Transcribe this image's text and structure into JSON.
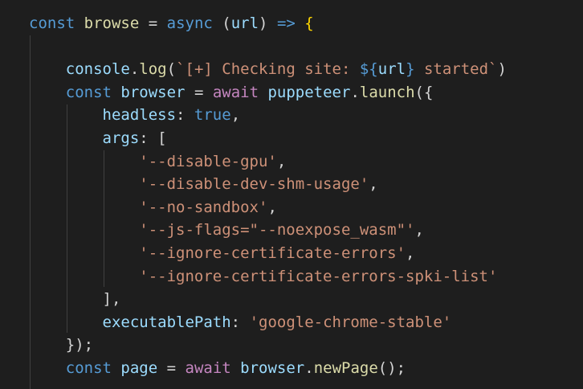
{
  "theme": {
    "background": "#1e1e1e",
    "keyword": "#569cd6",
    "control": "#c586c0",
    "variable": "#9cdcfe",
    "function": "#dcdcaa",
    "string": "#ce9178",
    "plain": "#d4d4d4",
    "bracket": "#ffd700",
    "guide": "#404040"
  },
  "code": {
    "lines": [
      [
        {
          "t": "const",
          "c": "keyword"
        },
        {
          "t": " ",
          "c": "plain"
        },
        {
          "t": "browse",
          "c": "function"
        },
        {
          "t": " = ",
          "c": "plain"
        },
        {
          "t": "async",
          "c": "keyword"
        },
        {
          "t": " (",
          "c": "plain"
        },
        {
          "t": "url",
          "c": "variable"
        },
        {
          "t": ") ",
          "c": "plain"
        },
        {
          "t": "=>",
          "c": "keyword"
        },
        {
          "t": " ",
          "c": "plain"
        },
        {
          "t": "{",
          "c": "bracket"
        }
      ],
      [],
      [
        {
          "t": "    ",
          "c": "plain"
        },
        {
          "t": "console",
          "c": "variable"
        },
        {
          "t": ".",
          "c": "plain"
        },
        {
          "t": "log",
          "c": "function"
        },
        {
          "t": "(",
          "c": "plain"
        },
        {
          "t": "`[+] Checking site: ",
          "c": "string"
        },
        {
          "t": "${",
          "c": "keyword"
        },
        {
          "t": "url",
          "c": "variable"
        },
        {
          "t": "}",
          "c": "keyword"
        },
        {
          "t": " started`",
          "c": "string"
        },
        {
          "t": ")",
          "c": "plain"
        }
      ],
      [
        {
          "t": "    ",
          "c": "plain"
        },
        {
          "t": "const",
          "c": "keyword"
        },
        {
          "t": " ",
          "c": "plain"
        },
        {
          "t": "browser",
          "c": "variable"
        },
        {
          "t": " = ",
          "c": "plain"
        },
        {
          "t": "await",
          "c": "control"
        },
        {
          "t": " ",
          "c": "plain"
        },
        {
          "t": "puppeteer",
          "c": "variable"
        },
        {
          "t": ".",
          "c": "plain"
        },
        {
          "t": "launch",
          "c": "function"
        },
        {
          "t": "({",
          "c": "plain"
        }
      ],
      [
        {
          "t": "        ",
          "c": "plain"
        },
        {
          "t": "headless",
          "c": "variable"
        },
        {
          "t": ": ",
          "c": "plain"
        },
        {
          "t": "true",
          "c": "keyword"
        },
        {
          "t": ",",
          "c": "plain"
        }
      ],
      [
        {
          "t": "        ",
          "c": "plain"
        },
        {
          "t": "args",
          "c": "variable"
        },
        {
          "t": ": [",
          "c": "plain"
        }
      ],
      [
        {
          "t": "            ",
          "c": "plain"
        },
        {
          "t": "'--disable-gpu'",
          "c": "string"
        },
        {
          "t": ",",
          "c": "plain"
        }
      ],
      [
        {
          "t": "            ",
          "c": "plain"
        },
        {
          "t": "'--disable-dev-shm-usage'",
          "c": "string"
        },
        {
          "t": ",",
          "c": "plain"
        }
      ],
      [
        {
          "t": "            ",
          "c": "plain"
        },
        {
          "t": "'--no-sandbox'",
          "c": "string"
        },
        {
          "t": ",",
          "c": "plain"
        }
      ],
      [
        {
          "t": "            ",
          "c": "plain"
        },
        {
          "t": "'--js-flags=\"--noexpose_wasm\"'",
          "c": "string"
        },
        {
          "t": ",",
          "c": "plain"
        }
      ],
      [
        {
          "t": "            ",
          "c": "plain"
        },
        {
          "t": "'--ignore-certificate-errors'",
          "c": "string"
        },
        {
          "t": ",",
          "c": "plain"
        }
      ],
      [
        {
          "t": "            ",
          "c": "plain"
        },
        {
          "t": "'--ignore-certificate-errors-spki-list'",
          "c": "string"
        }
      ],
      [
        {
          "t": "        ",
          "c": "plain"
        },
        {
          "t": "],",
          "c": "plain"
        }
      ],
      [
        {
          "t": "        ",
          "c": "plain"
        },
        {
          "t": "executablePath",
          "c": "variable"
        },
        {
          "t": ": ",
          "c": "plain"
        },
        {
          "t": "'google-chrome-stable'",
          "c": "string"
        }
      ],
      [
        {
          "t": "    ",
          "c": "plain"
        },
        {
          "t": "});",
          "c": "plain"
        }
      ],
      [
        {
          "t": "    ",
          "c": "plain"
        },
        {
          "t": "const",
          "c": "keyword"
        },
        {
          "t": " ",
          "c": "plain"
        },
        {
          "t": "page",
          "c": "variable"
        },
        {
          "t": " = ",
          "c": "plain"
        },
        {
          "t": "await",
          "c": "control"
        },
        {
          "t": " ",
          "c": "plain"
        },
        {
          "t": "browser",
          "c": "variable"
        },
        {
          "t": ".",
          "c": "plain"
        },
        {
          "t": "newPage",
          "c": "function"
        },
        {
          "t": "();",
          "c": "plain"
        }
      ]
    ]
  }
}
